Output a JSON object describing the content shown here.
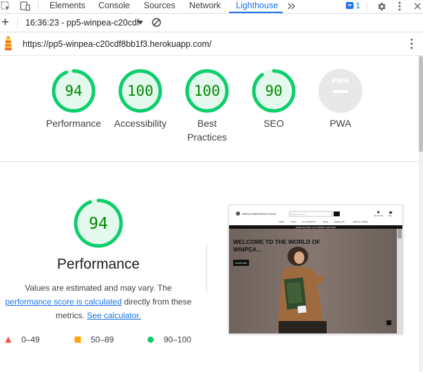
{
  "tabs": [
    "Elements",
    "Console",
    "Sources",
    "Network",
    "Lighthouse"
  ],
  "active_tab": "Lighthouse",
  "issues_count": "1",
  "toolbar": {
    "report_select": "16:36:23 - pp5-winpea-c20cdf"
  },
  "url": "https://pp5-winpea-c20cdf8bb1f3.herokuapp.com/",
  "categories": [
    {
      "label": "Performance",
      "score": 94
    },
    {
      "label": "Accessibility",
      "score": 100
    },
    {
      "label": "Best",
      "label2": "Practices",
      "score": 100
    },
    {
      "label": "SEO",
      "score": 90
    },
    {
      "label": "PWA",
      "badge": "PWA"
    }
  ],
  "performance": {
    "score": "94",
    "title": "Performance",
    "desc_line1": "Values are estimated and may vary. The",
    "link_score": "performance score is calculated",
    "desc_line2_rest": " directly from these",
    "desc_line3": "metrics. ",
    "link_calc": "See calculator."
  },
  "legend": {
    "fail": "0–49",
    "average": "50–89",
    "pass": "90–100"
  },
  "screenshot": {
    "brand": "WINPEA EMBROIDERED GOODS",
    "search_placeholder": "Search our site",
    "account": "My Account",
    "bag": "Bag",
    "nav": [
      "HOME",
      "SHOP",
      "ALL PRODUCTS",
      "BAGS",
      "JEWELLERY",
      "SPECIAL OFFERS"
    ],
    "banner": "FREE DELIVERY ON ORDERS OVER £50!",
    "hero_line1": "WELCOME TO THE WORLD OF",
    "hero_line2": "WINPEA...",
    "shop_button": "SHOP NOW"
  },
  "colors": {
    "pass": "#0cce6b",
    "pass_fill": "#e5f8ed",
    "pass_text": "#008800",
    "average": "#ffa400",
    "fail": "#ff4e42",
    "link": "#1a73e8"
  }
}
